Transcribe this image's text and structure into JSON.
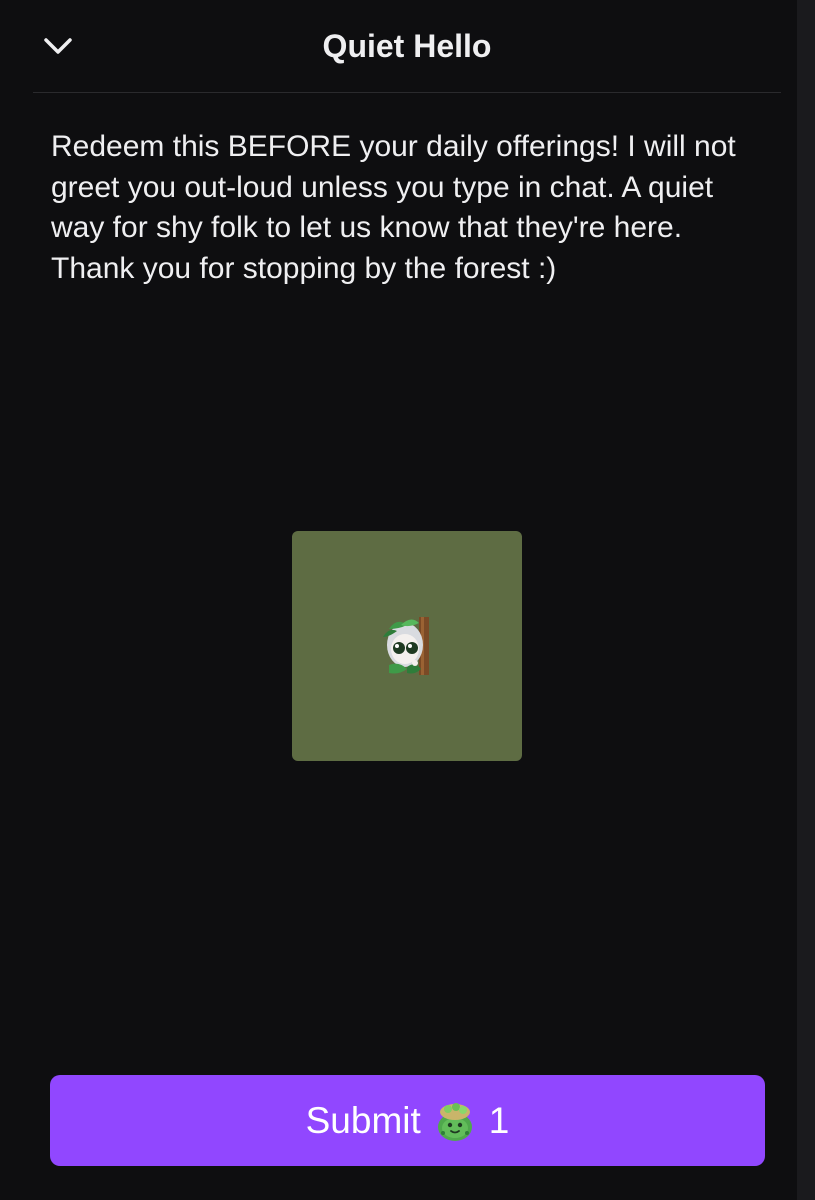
{
  "header": {
    "title": "Quiet Hello",
    "collapse_icon": "chevron-down-icon"
  },
  "reward": {
    "description": "Redeem this BEFORE your daily offerings! I will not greet you out-loud unless you type in chat. A quiet way for shy folk to let us know that they're here. Thank you for stopping by the forest :)",
    "image_background": "#5e6c43",
    "image_icon": "forest-girl-emote-icon"
  },
  "submit": {
    "label": "Submit",
    "points_icon": "channel-points-icon",
    "cost": "1",
    "color": "#9147ff"
  }
}
